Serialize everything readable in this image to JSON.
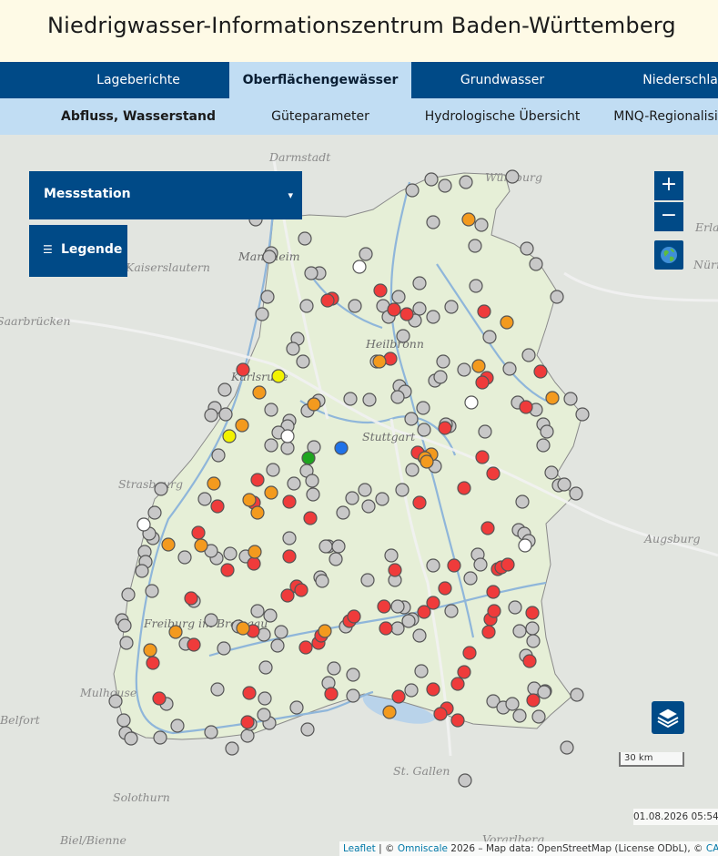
{
  "header": {
    "title": "Niedrigwasser-Informationszentrum Baden-Württemberg"
  },
  "main_nav": [
    {
      "label": "Lageberichte",
      "active": false
    },
    {
      "label": "Oberflächengewässer",
      "active": true
    },
    {
      "label": "Grundwasser",
      "active": false
    },
    {
      "label": "Niederschlag",
      "active": false
    }
  ],
  "sub_nav": [
    {
      "label": "Abfluss, Wasserstand",
      "active": true
    },
    {
      "label": "Güteparameter",
      "active": false
    },
    {
      "label": "Hydrologische Übersicht",
      "active": false
    },
    {
      "label": "MNQ-Regionalisierung",
      "active": false
    }
  ],
  "map": {
    "station_select": {
      "label": "Messstation",
      "caret": "▾"
    },
    "legend_button": {
      "label": "Legende",
      "icon": "list-icon"
    },
    "zoom_in": "+",
    "zoom_out": "−",
    "globe_icon": "globe-icon",
    "layers_icon": "layers-icon",
    "scale_label": "30 km",
    "timestamp": "01.08.2026 05:54",
    "attribution": {
      "leaflet": "Leaflet",
      "sep1": " | © ",
      "omniscale": "Omniscale",
      "text": " 2026 – Map data: OpenStreetMap (License ODbL), © ",
      "carto": "CARTO"
    },
    "cities": [
      "Darmstadt",
      "Würzburg",
      "Mannheim",
      "Kaiserslautern",
      "Saarbrücken",
      "Heilbronn",
      "Karlsruhe",
      "Stuttgart",
      "Strasbourg",
      "Augsburg",
      "Freiburg im Breisgau",
      "Mulhouse",
      "St. Gallen",
      "Erlangen",
      "Nürnberg",
      "Belfort",
      "Biel/Bienne",
      "Solothurn",
      "Vorarlberg"
    ],
    "colors": {
      "grey": "#c8c8c8",
      "red": "#ef3b3b",
      "orange": "#f39a1e",
      "yellow": "#f2f200",
      "green": "#1fa51f",
      "blue": "#1f72e8",
      "white": "#ffffff",
      "nav_blue": "#004a87",
      "light_blue": "#c1ddf3"
    },
    "station_counts": {
      "grey": 254,
      "red": 94,
      "orange": 27,
      "yellow": 2,
      "green": 1,
      "blue": 1,
      "white": 6
    }
  }
}
